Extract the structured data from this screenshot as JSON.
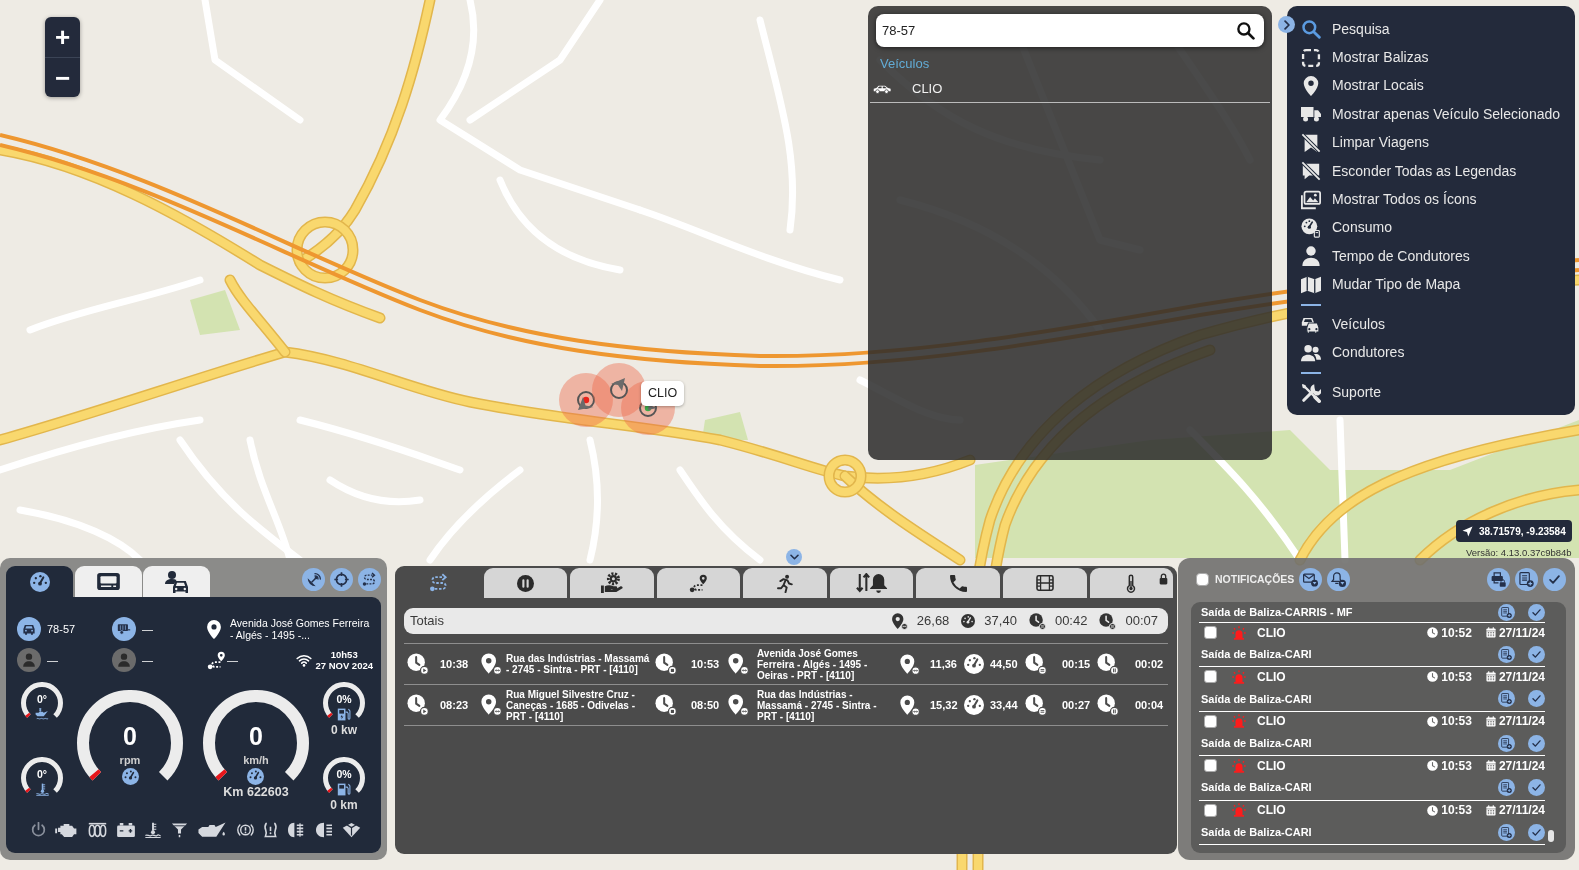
{
  "map": {
    "zoom_in": "+",
    "zoom_out": "−",
    "vehicle_label": "CLIO",
    "coordinates": "38.71579, -9.23584",
    "version": "Versão: 4.13.0.37c9b84b"
  },
  "search_panel": {
    "query": "78-57",
    "section": "Veículos",
    "results": [
      {
        "label": "CLIO",
        "selected": false
      }
    ]
  },
  "menu": {
    "sections": [
      {
        "items": [
          {
            "label": "Pesquisa",
            "selected": true
          },
          {
            "label": "Mostrar Balizas",
            "selected": false
          },
          {
            "label": "Mostrar Locais",
            "selected": false
          },
          {
            "label": "Mostrar apenas Veículo Selecionado",
            "selected": false
          },
          {
            "label": "Limpar Viagens",
            "selected": false
          },
          {
            "label": "Esconder Todas as Legendas",
            "selected": false
          },
          {
            "label": "Mostrar Todos os Ícons",
            "selected": false
          },
          {
            "label": "Consumo",
            "selected": false
          },
          {
            "label": "Tempo de Condutores",
            "selected": false
          },
          {
            "label": "Mudar Tipo de Mapa",
            "selected": false
          }
        ]
      },
      {
        "items": [
          {
            "label": "Veículos",
            "selected": false
          },
          {
            "label": "Condutores",
            "selected": false
          }
        ]
      },
      {
        "items": [
          {
            "label": "Suporte",
            "selected": false
          }
        ]
      }
    ]
  },
  "dashboard": {
    "tabs": [
      {
        "selected": true
      },
      {
        "selected": false
      },
      {
        "selected": false
      }
    ],
    "plate": "78-57",
    "trailer": "—",
    "driver": "—",
    "co_driver": "—",
    "address": "Avenida José Gomes Ferreira - Algés - 1495 -...",
    "route": "—",
    "time": "10h53",
    "date": "27 NOV 2024",
    "gauge_columns": [
      {
        "gauges": [
          {
            "kind": "small",
            "reading": "0°"
          },
          {
            "kind": "small",
            "reading": "0°"
          }
        ]
      },
      {
        "gauges": [
          {
            "kind": "large",
            "reading": "0",
            "unit": "rpm"
          }
        ]
      },
      {
        "gauges": [
          {
            "kind": "large",
            "reading": "0",
            "unit": "km/h",
            "odometer": "Km 622603"
          }
        ]
      },
      {
        "gauges": [
          {
            "kind": "small",
            "reading": "0%",
            "caption": "0 kw"
          },
          {
            "kind": "small",
            "reading": "0%",
            "caption": "0 km"
          }
        ]
      }
    ]
  },
  "trips": {
    "tabs": [
      {
        "selected": true
      },
      {
        "selected": false
      },
      {
        "selected": false
      },
      {
        "selected": false
      },
      {
        "selected": false
      },
      {
        "selected": false
      },
      {
        "selected": false
      },
      {
        "selected": false
      },
      {
        "selected": false
      }
    ],
    "totals": {
      "label": "Totais",
      "distance": "26,68",
      "speed": "37,40",
      "duration": "00:42",
      "stopped": "00:07"
    },
    "rows": [
      {
        "start_time": "10:38",
        "start_place": "Rua das Indústrias - Massamá - 2745 - Sintra - PRT - [4110]",
        "end_time": "10:53",
        "end_place": "Avenida José Gomes Ferreira - Algés - 1495 - Oeiras - PRT - [4110]",
        "distance": "11,36",
        "speed": "44,50",
        "duration": "00:15",
        "stopped": "00:02"
      },
      {
        "start_time": "08:23",
        "start_place": "Rua Miguel Silvestre Cruz - Caneças - 1685 - Odivelas - PRT - [4110]",
        "end_time": "08:50",
        "end_place": "Rua das Indústrias - Massamá - 2745 - Sintra - PRT - [4110]",
        "distance": "15,32",
        "speed": "33,44",
        "duration": "00:27",
        "stopped": "00:04"
      }
    ]
  },
  "notifications": {
    "title": "NOTIFICAÇÕES",
    "checked": false,
    "scrolled_item": {
      "message": "Saída de Baliza-CARRIS - MF"
    },
    "items": [
      {
        "checked": false,
        "vehicle": "CLIO",
        "time": "10:52",
        "date": "27/11/24",
        "message": "Saída de Baliza-CARI"
      },
      {
        "checked": false,
        "vehicle": "CLIO",
        "time": "10:53",
        "date": "27/11/24",
        "message": "Saída de Baliza-CARI"
      },
      {
        "checked": false,
        "vehicle": "CLIO",
        "time": "10:53",
        "date": "27/11/24",
        "message": "Saída de Baliza-CARI"
      },
      {
        "checked": false,
        "vehicle": "CLIO",
        "time": "10:53",
        "date": "27/11/24",
        "message": "Saída de Baliza-CARI"
      },
      {
        "checked": false,
        "vehicle": "CLIO",
        "time": "10:53",
        "date": "27/11/24",
        "message": "Saída de Baliza-CARI"
      }
    ]
  }
}
